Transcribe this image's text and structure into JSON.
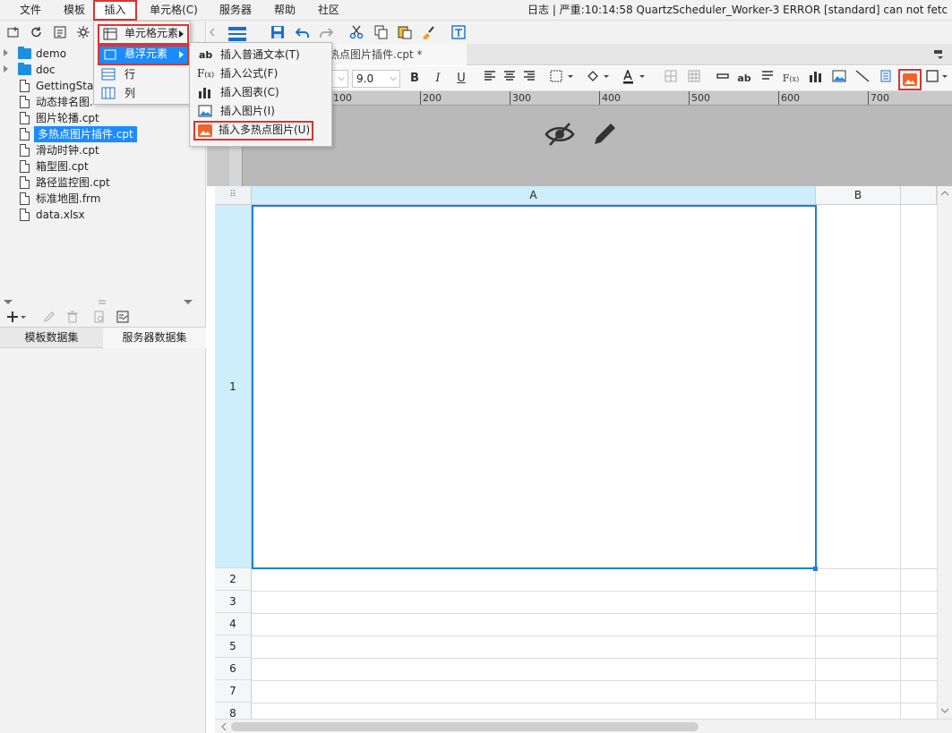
{
  "menubar": {
    "items": [
      "文件",
      "模板",
      "插入",
      "单元格(C)",
      "服务器",
      "帮助",
      "社区"
    ],
    "active_index": 2,
    "log": "日志 | 严重:10:14:58 QuartzScheduler_Worker-3 ERROR [standard] can not fetch"
  },
  "tree": {
    "items": [
      {
        "type": "folder",
        "label": "demo",
        "expandable": true
      },
      {
        "type": "folder",
        "label": "doc",
        "expandable": true
      },
      {
        "type": "file",
        "label": "GettingStar"
      },
      {
        "type": "file",
        "label": "动态排名图."
      },
      {
        "type": "file",
        "label": "图片轮播.cpt"
      },
      {
        "type": "file",
        "label": "多热点图片插件.cpt",
        "selected": true
      },
      {
        "type": "file",
        "label": "滑动时钟.cpt"
      },
      {
        "type": "file",
        "label": "箱型图.cpt"
      },
      {
        "type": "file",
        "label": "路径监控图.cpt"
      },
      {
        "type": "file",
        "label": "标准地图.frm"
      },
      {
        "type": "file",
        "label": "data.xlsx"
      }
    ]
  },
  "dataset_tabs": [
    "模板数据集",
    "服务器数据集"
  ],
  "doc_tab": {
    "title": "热点图片插件.cpt *"
  },
  "format_bar": {
    "font_size": "9.0"
  },
  "ruler": {
    "ticks": [
      "100",
      "200",
      "300",
      "400",
      "500",
      "600",
      "700"
    ]
  },
  "grid": {
    "columns": [
      "A",
      "B"
    ],
    "rows": [
      "1",
      "2",
      "3",
      "4",
      "5",
      "6",
      "7",
      "8"
    ]
  },
  "insert_menu": {
    "items": [
      {
        "label": "单元格元素",
        "submenu": true
      },
      {
        "label": "悬浮元素",
        "submenu": true,
        "highlighted": true
      },
      {
        "label": "行",
        "submenu": false
      },
      {
        "label": "列",
        "submenu": false
      }
    ]
  },
  "float_submenu": {
    "items": [
      {
        "label": "插入普通文本(T)",
        "icon": "text-ab-icon"
      },
      {
        "label": "插入公式(F)",
        "icon": "formula-icon"
      },
      {
        "label": "插入图表(C)",
        "icon": "bar-chart-icon"
      },
      {
        "label": "插入图片(I)",
        "icon": "image-icon"
      },
      {
        "label": "插入多热点图片(U)",
        "icon": "hotspot-image-icon",
        "outlined": true
      }
    ]
  },
  "colors": {
    "accent": "#1a8cff",
    "highlight_outline": "#e0322f",
    "selection_border": "#1a7fe0",
    "selected_header": "#cdeefa",
    "hotspot_icon": "#f0642a"
  }
}
